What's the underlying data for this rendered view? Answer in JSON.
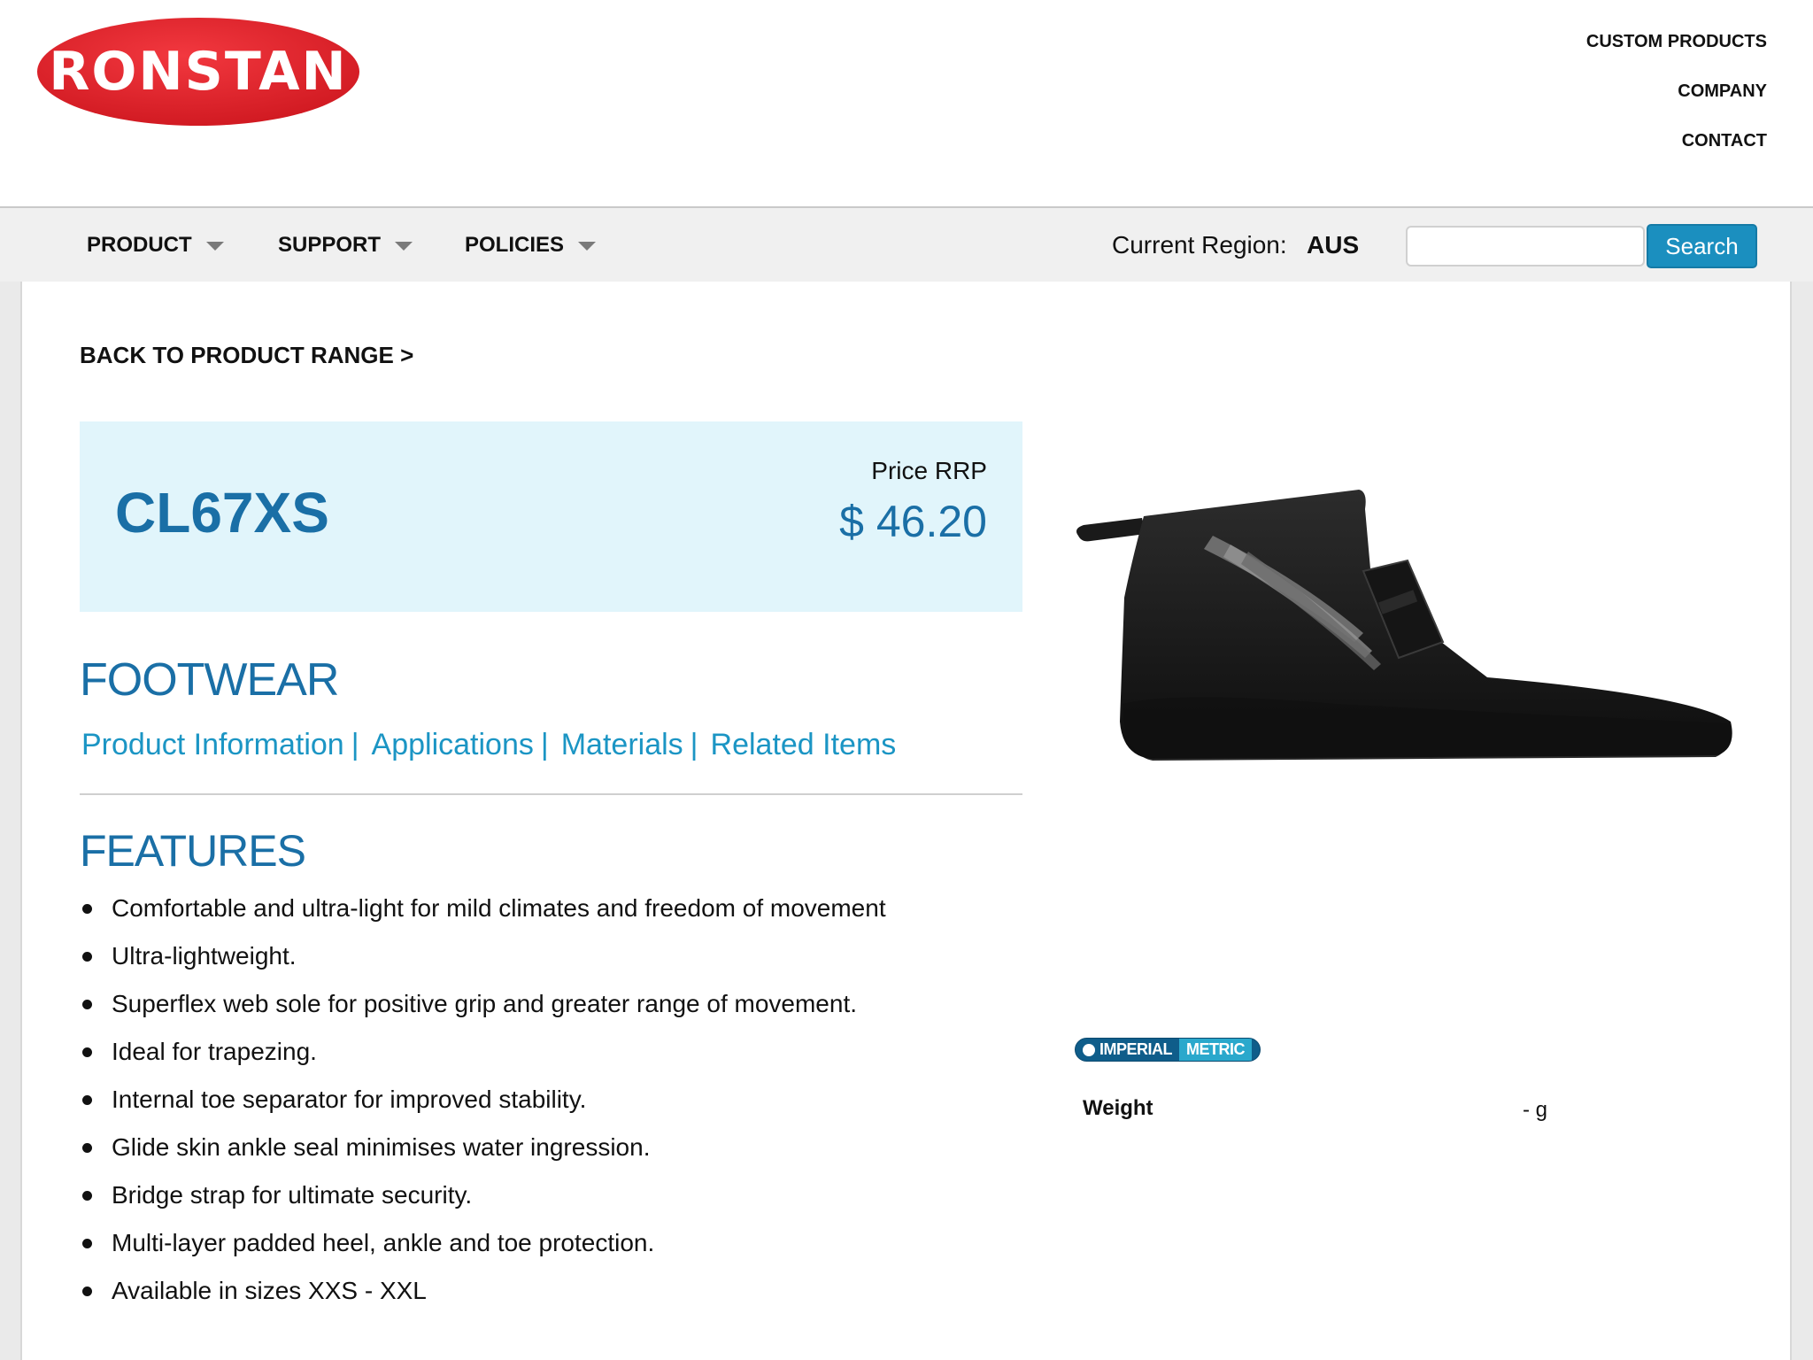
{
  "brand": {
    "logo_text": "RONSTAN",
    "logo_color": "#e8202a"
  },
  "top_links": [
    "CUSTOM PRODUCTS",
    "COMPANY",
    "CONTACT"
  ],
  "nav": {
    "items": [
      "PRODUCT",
      "SUPPORT",
      "POLICIES"
    ],
    "region_label": "Current Region:",
    "region_value": "AUS",
    "search_value": "",
    "search_button": "Search"
  },
  "back_link": "BACK TO PRODUCT RANGE >",
  "product": {
    "code": "CL67XS",
    "price_label": "Price RRP",
    "price": "$ 46.20",
    "category": "FOOTWEAR"
  },
  "tabs": [
    "Product Information",
    "Applications",
    "Materials",
    "Related Items"
  ],
  "features": {
    "title": "FEATURES",
    "items": [
      "Comfortable and ultra-light for mild climates and freedom of movement",
      "Ultra-lightweight.",
      "Superflex web sole for positive grip and greater range of movement.",
      "Ideal for trapezing.",
      "Internal toe separator for improved stability.",
      "Glide skin ankle seal minimises water ingression.",
      "Bridge strap for ultimate security.",
      "Multi-layer padded heel, ankle and toe protection.",
      "Available in sizes XXS - XXL"
    ]
  },
  "units": {
    "imperial": "IMPERIAL",
    "metric": "METRIC",
    "selected": "IMPERIAL"
  },
  "specs": {
    "weight_label": "Weight",
    "weight_value": "- g"
  },
  "colors": {
    "accent_blue": "#1a6fa6",
    "link_blue": "#1b95c4",
    "price_box_bg": "#e1f5fb",
    "search_button": "#1b8fbf"
  }
}
